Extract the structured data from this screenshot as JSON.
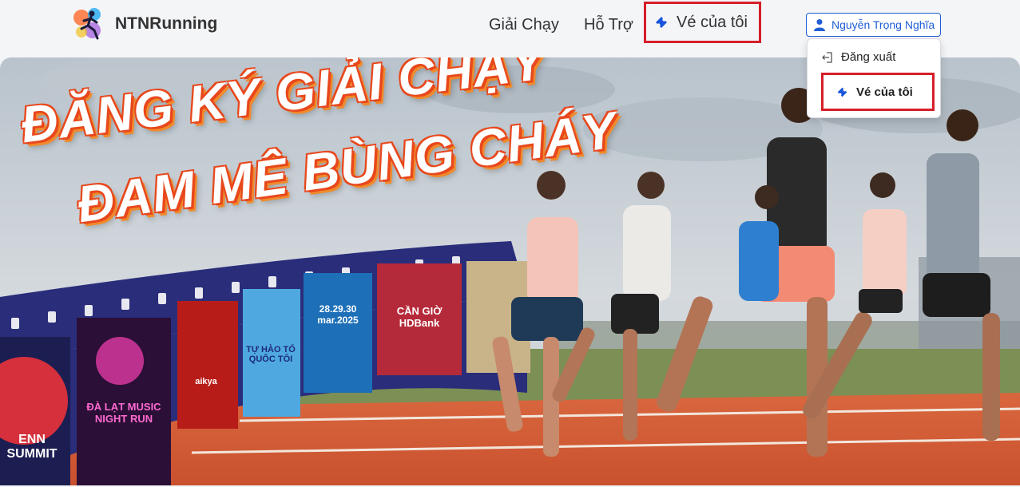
{
  "brand": {
    "name": "NTNRunning",
    "logo_icon": "runner-logo-icon"
  },
  "nav": {
    "items": [
      {
        "label": "Giải Chạy"
      },
      {
        "label": "Hỗ Trợ"
      },
      {
        "label": "Vé của tôi",
        "icon": "ticket-icon"
      }
    ]
  },
  "user": {
    "name": "Nguyễn Trọng Nghĩa",
    "icon": "user-icon"
  },
  "dropdown": {
    "items": [
      {
        "label": "Đăng xuất",
        "icon": "logout-icon"
      },
      {
        "label": "Vé của tôi",
        "icon": "ticket-icon"
      }
    ]
  },
  "hero": {
    "headline_line1": "ĐĂNG KÝ GIẢI CHẠY",
    "headline_line2": "ĐAM MÊ BÙNG CHÁY",
    "posters": [
      {
        "text": "ENN SUMMIT"
      },
      {
        "text": "ĐÀ LẠT MUSIC NIGHT RUN"
      },
      {
        "text": "aikya"
      },
      {
        "text": "TỰ HÀO TỔ QUỐC TÔI"
      },
      {
        "text": "28.29.30 mar.2025"
      },
      {
        "text": "CẦN GIỜ HDBank"
      }
    ]
  },
  "colors": {
    "highlight": "#d51f2a",
    "primary": "#1f5fd6",
    "ticket": "#1a56db",
    "track": "#e0603a",
    "film": "#2a2d7a"
  }
}
